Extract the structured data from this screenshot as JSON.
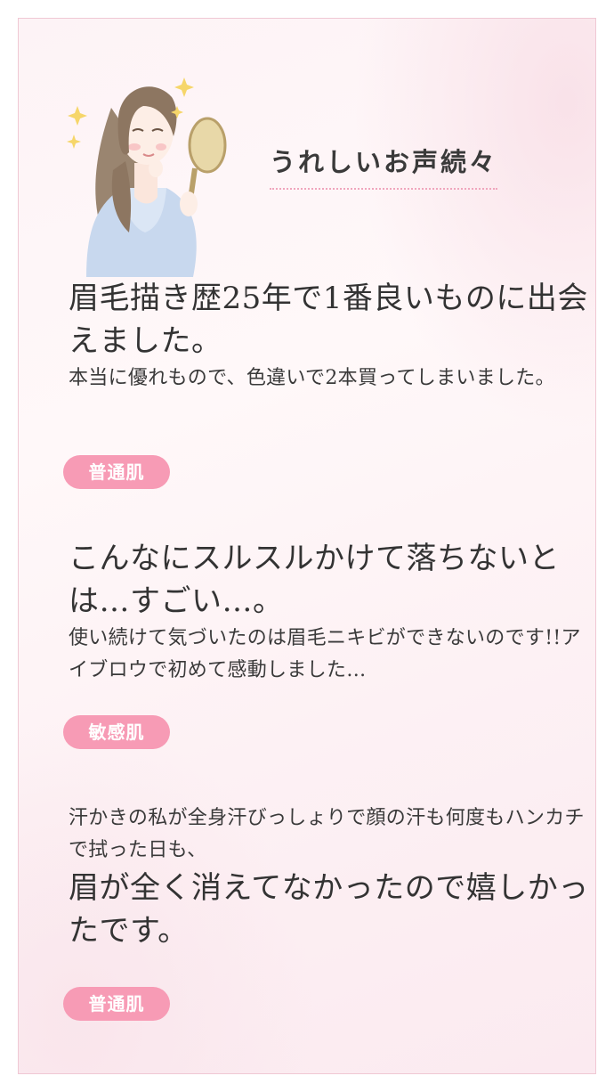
{
  "header": {
    "title": "うれしいお声続々"
  },
  "reviews": [
    {
      "lead": "眉毛描き歴25年で1番良いものに出会えました。",
      "body": "本当に優れもので、色違いで2本買ってしまいました。",
      "badge": "普通肌"
    },
    {
      "lead": "こんなにスルスルかけて落ちないとは…すごい…。",
      "body": "使い続けて気づいたのは眉毛ニキビができないのです!!アイブロウで初めて感動しました…",
      "badge": "敏感肌"
    },
    {
      "body": "汗かきの私が全身汗びっしょりで顔の汗も何度もハンカチで拭った日も、",
      "lead": "眉が全く消えてなかったので嬉しかったです。",
      "badge": "普通肌"
    }
  ],
  "colors": {
    "accent_pink": "#f79bb5",
    "border_pink": "#f0c8d4",
    "dotted_underline": "#f0a6bd"
  },
  "icons": [
    "woman-with-mirror-illustration",
    "sparkle-icon"
  ]
}
